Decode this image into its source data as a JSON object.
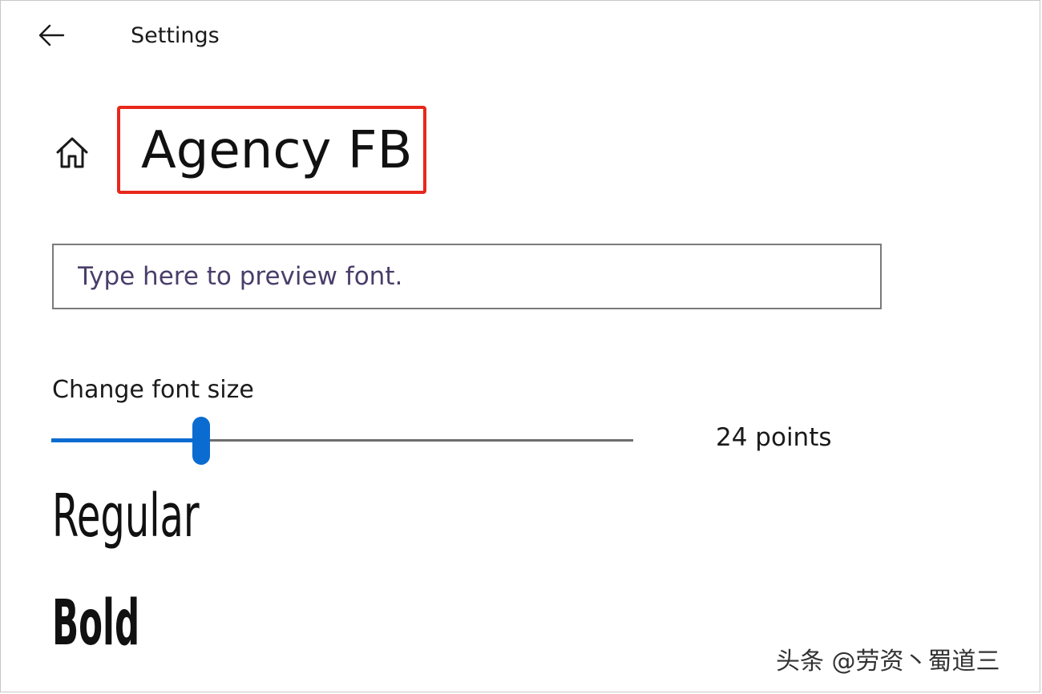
{
  "header": {
    "back_icon": "back-arrow-icon",
    "title": "Settings"
  },
  "font_page": {
    "home_icon": "home-icon",
    "font_name": "Agency FB",
    "highlight_color": "#e8271b"
  },
  "preview": {
    "placeholder": "Type here to preview font.",
    "value": ""
  },
  "font_size": {
    "label": "Change font size",
    "value_text": "24 points",
    "slider_fraction": 0.257,
    "accent_color": "#0a6cd0"
  },
  "styles": {
    "regular": "Regular",
    "bold": "Bold"
  },
  "watermark": "头条 @劳资丶蜀道三"
}
